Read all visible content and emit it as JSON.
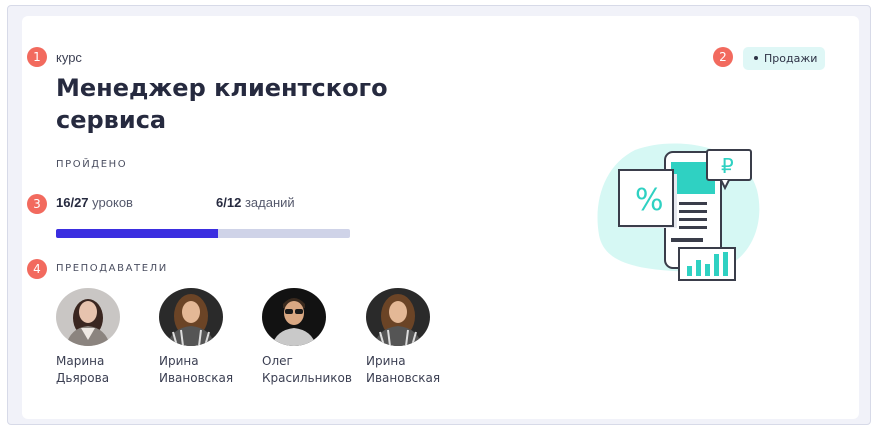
{
  "markers": [
    "1",
    "2",
    "3",
    "4"
  ],
  "course": {
    "kind": "курс",
    "title": "Менеджер клиентского сервиса",
    "tag": "Продажи"
  },
  "progress": {
    "label": "ПРОЙДЕНО",
    "lessons_done": "16/27",
    "lessons_word": "уроков",
    "tasks_done": "6/12",
    "tasks_word": "заданий",
    "fraction": 0.55
  },
  "teachers": {
    "label": "ПРЕПОДАВАТЕЛИ",
    "list": [
      {
        "first": "Марина",
        "last": "Дьярова"
      },
      {
        "first": "Ирина",
        "last": "Ивановская"
      },
      {
        "first": "Олег",
        "last": "Красильников"
      },
      {
        "first": "Ирина",
        "last": "Ивановская"
      }
    ]
  },
  "illustration": {
    "percent_symbol": "%",
    "currency_symbol": "₽"
  },
  "colors": {
    "marker": "#f26a5e",
    "progress_fill": "#3b2ee0",
    "progress_track": "#cfd3e8",
    "tag_bg": "#dff7f6",
    "illustration_accent": "#2fd1c2"
  }
}
